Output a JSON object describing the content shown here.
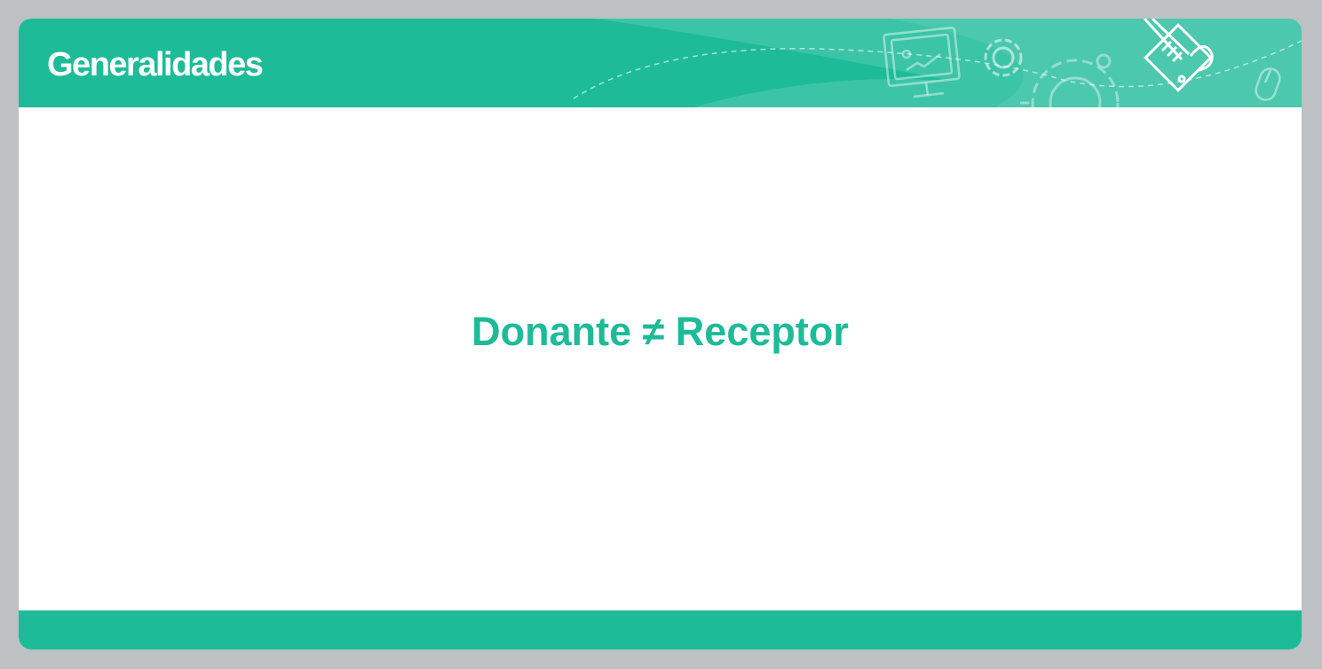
{
  "header": {
    "title": "Generalidades"
  },
  "content": {
    "statement": "Donante ≠ Receptor"
  },
  "icons": [
    "presentation-screen-icon",
    "gear-icon",
    "large-gear-icon",
    "strategy-board-icon",
    "mouse-icon"
  ],
  "colors": {
    "accent": "#1dbb98",
    "background": "#ffffff",
    "frame": "#bdc1c4"
  }
}
